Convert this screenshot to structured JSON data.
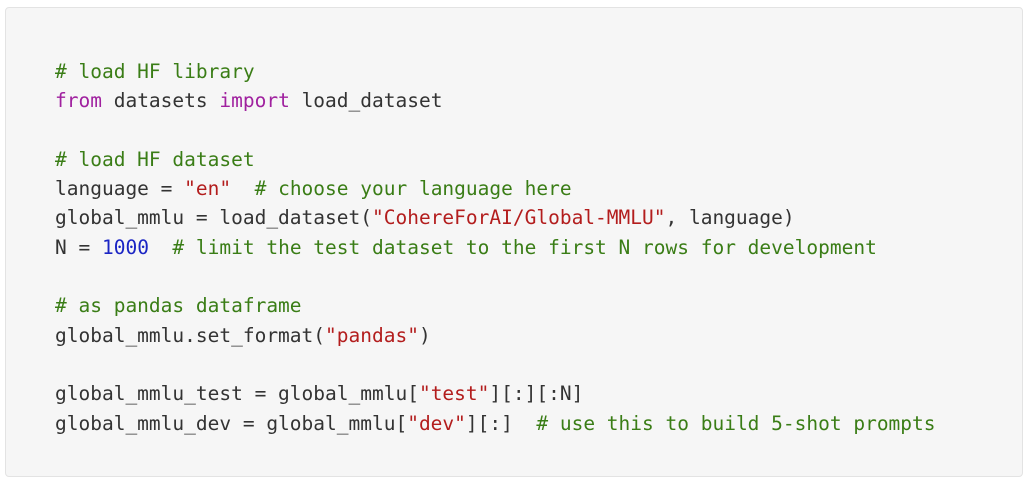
{
  "code": {
    "lines": [
      [
        {
          "t": "c",
          "v": "# load HF library"
        }
      ],
      [
        {
          "t": "k",
          "v": "from"
        },
        {
          "t": "p",
          "v": " datasets "
        },
        {
          "t": "k",
          "v": "import"
        },
        {
          "t": "p",
          "v": " load_dataset"
        }
      ],
      [],
      [
        {
          "t": "c",
          "v": "# load HF dataset"
        }
      ],
      [
        {
          "t": "p",
          "v": "language = "
        },
        {
          "t": "s",
          "v": "\"en\""
        },
        {
          "t": "p",
          "v": "  "
        },
        {
          "t": "c",
          "v": "# choose your language here"
        }
      ],
      [
        {
          "t": "p",
          "v": "global_mmlu = load_dataset("
        },
        {
          "t": "s",
          "v": "\"CohereForAI/Global-MMLU\""
        },
        {
          "t": "p",
          "v": ", language)"
        }
      ],
      [
        {
          "t": "p",
          "v": "N = "
        },
        {
          "t": "n",
          "v": "1000"
        },
        {
          "t": "p",
          "v": "  "
        },
        {
          "t": "c",
          "v": "# limit the test dataset to the first N rows for development"
        }
      ],
      [],
      [
        {
          "t": "c",
          "v": "# as pandas dataframe"
        }
      ],
      [
        {
          "t": "p",
          "v": "global_mmlu.set_format("
        },
        {
          "t": "s",
          "v": "\"pandas\""
        },
        {
          "t": "p",
          "v": ")"
        }
      ],
      [],
      [
        {
          "t": "p",
          "v": "global_mmlu_test = global_mmlu["
        },
        {
          "t": "s",
          "v": "\"test\""
        },
        {
          "t": "p",
          "v": "][:][:N]"
        }
      ],
      [
        {
          "t": "p",
          "v": "global_mmlu_dev = global_mmlu["
        },
        {
          "t": "s",
          "v": "\"dev\""
        },
        {
          "t": "p",
          "v": "][:]  "
        },
        {
          "t": "c",
          "v": "# use this to build 5-shot prompts"
        }
      ]
    ]
  }
}
